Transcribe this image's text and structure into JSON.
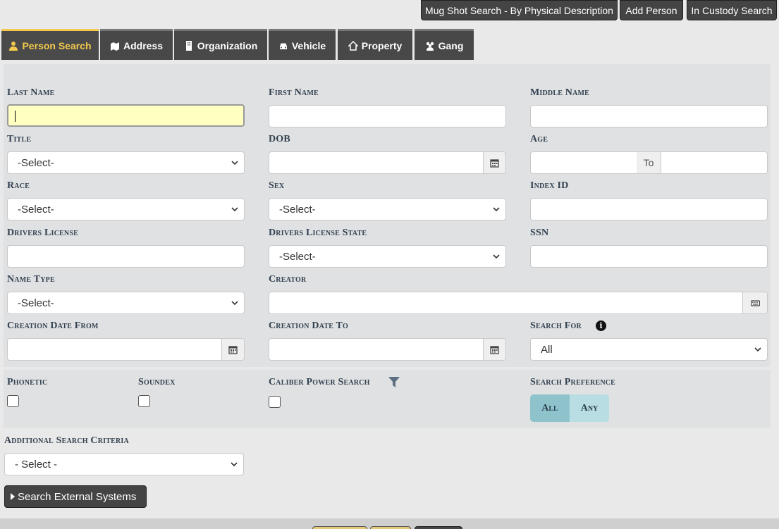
{
  "top_buttons": {
    "mugshot": "Mug Shot Search - By Physical Description",
    "add_person": "Add Person",
    "in_custody": "In Custody Search"
  },
  "tabs": [
    {
      "label": "Person Search",
      "icon": "person-icon"
    },
    {
      "label": "Address",
      "icon": "map-icon"
    },
    {
      "label": "Organization",
      "icon": "building-icon"
    },
    {
      "label": "Vehicle",
      "icon": "car-icon"
    },
    {
      "label": "Property",
      "icon": "property-icon"
    },
    {
      "label": "Gang",
      "icon": "users-icon"
    }
  ],
  "form": {
    "last_name": "Last Name",
    "first_name": "First Name",
    "middle_name": "Middle Name",
    "title": "Title",
    "dob": "DOB",
    "age": "Age",
    "age_to": "To",
    "race": "Race",
    "sex": "Sex",
    "index_id": "Index ID",
    "drivers_license": "Drivers License",
    "drivers_license_state": "Drivers License State",
    "ssn": "SSN",
    "name_type": "Name Type",
    "creator": "Creator",
    "creation_date_from": "Creation Date From",
    "creation_date_to": "Creation Date To",
    "search_for": "Search For",
    "select_default": "-Select-",
    "search_for_value": "All"
  },
  "options": {
    "phonetic": "Phonetic",
    "soundex": "Soundex",
    "caliber_power_search": "Caliber Power Search",
    "search_preference": "Search Preference",
    "pref_all": "All",
    "pref_any": "Any"
  },
  "additional": {
    "label": "Additional Search Criteria",
    "select_value": "- Select -"
  },
  "external_button": "Search External Systems"
}
